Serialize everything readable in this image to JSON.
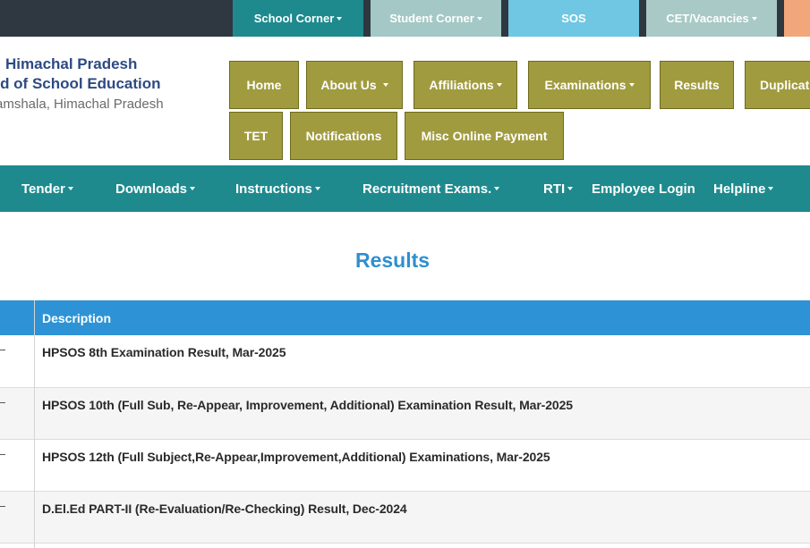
{
  "topbar": {
    "school_corner": "School Corner",
    "student_corner": "Student Corner",
    "sos": "SOS",
    "cet_vacancies": "CET/Vacancies"
  },
  "brand": {
    "line1": "Himachal Pradesh",
    "line2": "ard of School Education",
    "line3": "ramshala, Himachal Pradesh"
  },
  "nav": {
    "home": "Home",
    "about": "About Us",
    "affiliations": "Affiliations",
    "examinations": "Examinations",
    "results": "Results",
    "duplicate": "Duplicat",
    "tet": "TET",
    "notifications": "Notifications",
    "misc_payment": "Misc Online Payment"
  },
  "main_menu": {
    "tender": "Tender",
    "downloads": "Downloads",
    "instructions": "Instructions",
    "recruitment": "Recruitment Exams.",
    "rti": "RTI",
    "employee_login": "Employee Login",
    "helpline": "Helpline"
  },
  "page": {
    "title": "Results"
  },
  "table": {
    "header_description": "Description",
    "rows": [
      {
        "description": "HPSOS 8th Examination Result, Mar-2025"
      },
      {
        "description": "HPSOS 10th (Full Sub, Re-Appear, Improvement, Additional) Examination Result, Mar-2025"
      },
      {
        "description": "HPSOS 12th (Full Subject,Re-Appear,Improvement,Additional) Examinations, Mar-2025"
      },
      {
        "description": "D.El.Ed PART-II (Re-Evaluation/Re-Checking) Result, Dec-2024"
      }
    ]
  },
  "colors": {
    "topbar_bg": "#2f3741",
    "teal": "#1e8a8d",
    "olive": "#a09b3f",
    "table_header": "#2e93d6",
    "title_blue": "#2f8fcf",
    "brand_navy": "#2d4a82"
  },
  "icons": {
    "dropdown": "caret-down-icon"
  }
}
